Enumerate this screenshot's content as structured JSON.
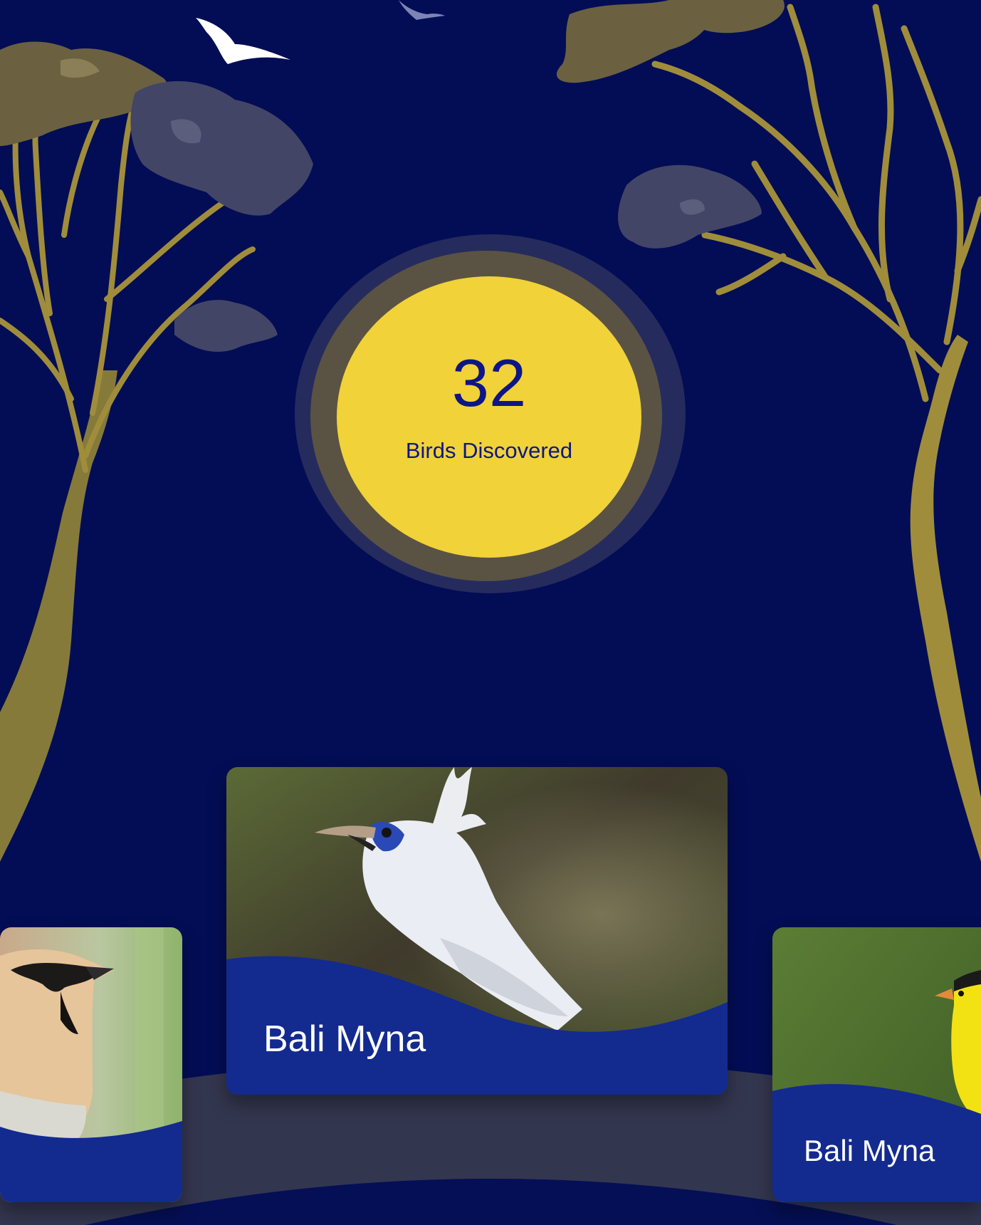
{
  "counter": {
    "value": "32",
    "label": "Birds Discovered"
  },
  "birds": [
    {
      "name": "Bali Myna",
      "position": "featured"
    },
    {
      "name": "",
      "position": "left"
    },
    {
      "name": "Bali Myna",
      "position": "right"
    }
  ],
  "colors": {
    "background": "#030d55",
    "accent_yellow": "#f1d238",
    "card_band": "#132a8f",
    "tree_gold": "#a08d3b",
    "stage": "#33364f"
  },
  "icons": [
    "flying-bird-icon",
    "tree-left-illustration",
    "tree-right-illustration"
  ]
}
